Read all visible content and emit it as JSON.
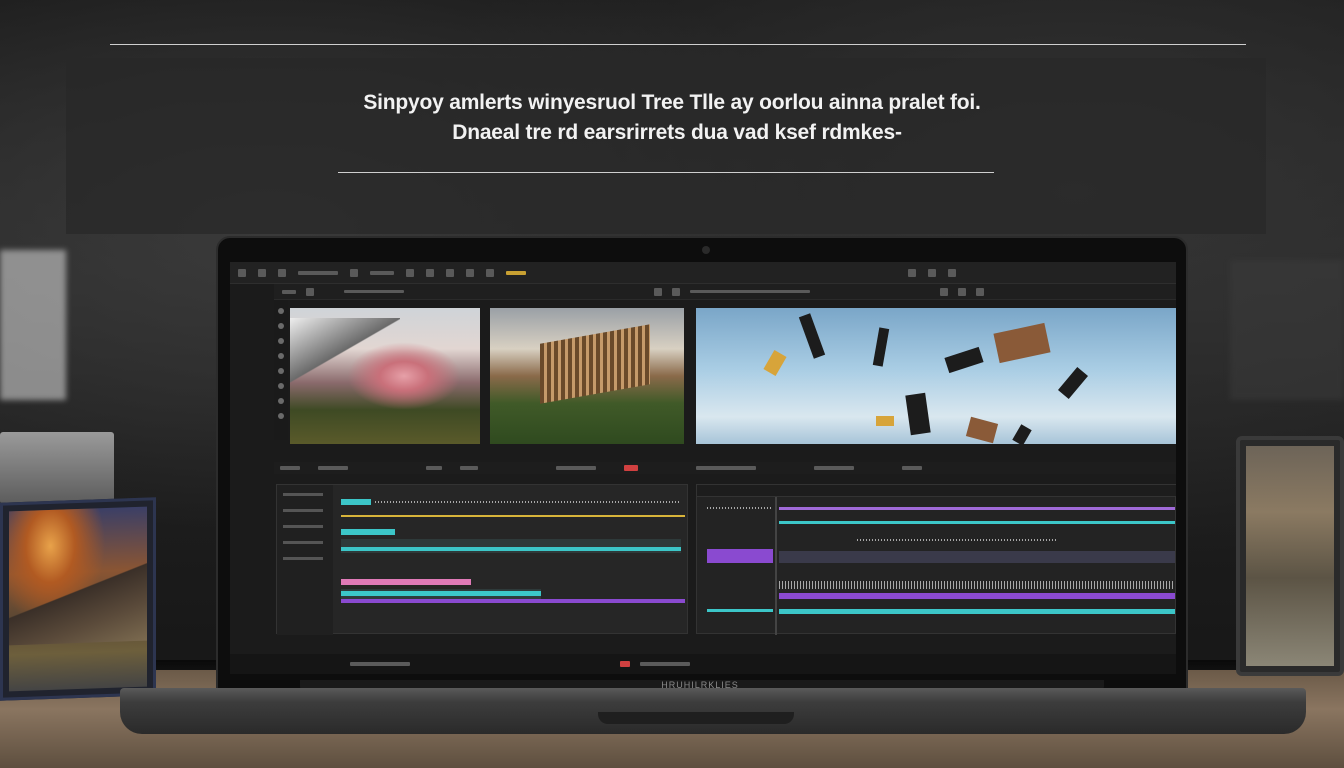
{
  "headline": {
    "line1": "Sinpyoy amlerts winyesruol Tree Tlle ay oorlou ainna pralet foi.",
    "line2": "Dnaeal tre rd earsrirrets dua vad ksef rdmkes-"
  },
  "laptop": {
    "brand_label": "HRUHILRKLIES"
  },
  "colors": {
    "accent_cyan": "#3cc6c8",
    "accent_purple": "#8a4ad0",
    "accent_pink": "#e07ab8",
    "accent_yellow": "#d8b43a",
    "record_red": "#d04040"
  },
  "icons": [
    "play-icon",
    "stop-icon",
    "record-icon",
    "settings-icon",
    "zoom-icon"
  ]
}
